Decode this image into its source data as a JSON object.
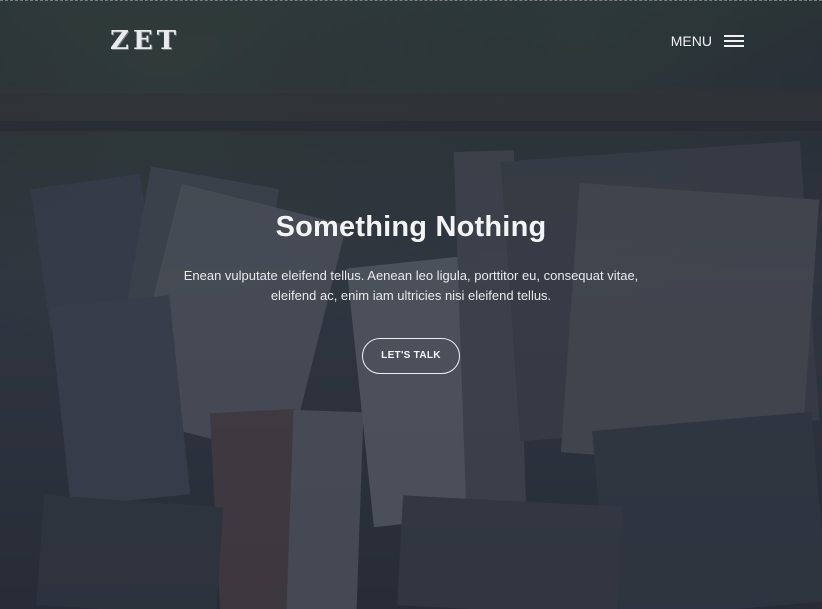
{
  "header": {
    "logo": "ZET",
    "menu_label": "MENU"
  },
  "hero": {
    "title": "Something Nothing",
    "description": "Enean vulputate eleifend tellus. Aenean leo ligula, porttitor eu, consequat vitae, eleifend ac, enim iam ultricies nisi eleifend tellus.",
    "cta_label": "LET'S TALK"
  },
  "colors": {
    "overlay": "#2e3440",
    "text": "#f3f4f6"
  },
  "icons": {
    "menu": "hamburger-icon"
  }
}
